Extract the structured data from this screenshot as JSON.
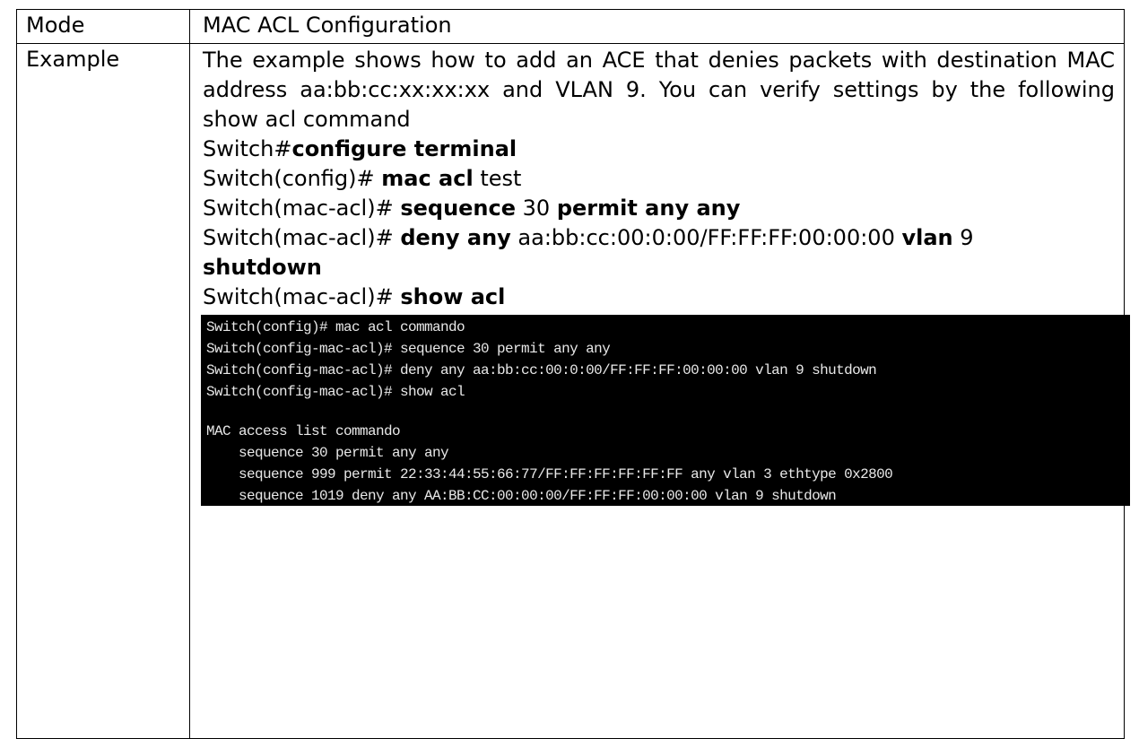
{
  "rows": {
    "mode": {
      "label": "Mode",
      "value": "MAC ACL Configuration"
    },
    "example": {
      "label": "Example",
      "description": "The example shows how to add an ACE that denies packets with destination MAC address aa:bb:cc:xx:xx:xx and VLAN 9. You can verify settings by the following show acl command",
      "commands": [
        {
          "prefix": "Switch#",
          "parts": [
            {
              "text": "configure terminal",
              "bold": true
            }
          ]
        },
        {
          "prefix": "Switch(config)# ",
          "parts": [
            {
              "text": "mac acl",
              "bold": true
            },
            {
              "text": " test",
              "bold": false
            }
          ]
        },
        {
          "prefix": "Switch(mac-acl)# ",
          "parts": [
            {
              "text": "sequence",
              "bold": true
            },
            {
              "text": " 30 ",
              "bold": false
            },
            {
              "text": "permit any any",
              "bold": true
            }
          ]
        },
        {
          "prefix": "Switch(mac-acl)# ",
          "parts": [
            {
              "text": "deny any",
              "bold": true
            },
            {
              "text": " aa:bb:cc:00:0:00/FF:FF:FF:00:00:00 ",
              "bold": false
            },
            {
              "text": "vlan",
              "bold": true
            },
            {
              "text": " 9",
              "bold": false
            }
          ]
        },
        {
          "prefix": "",
          "parts": [
            {
              "text": "shutdown",
              "bold": true
            }
          ]
        },
        {
          "prefix": "Switch(mac-acl)# ",
          "parts": [
            {
              "text": "show acl",
              "bold": true
            }
          ]
        }
      ],
      "terminal": [
        "Switch(config)# mac acl commando",
        "Switch(config-mac-acl)# sequence 30 permit any any",
        "Switch(config-mac-acl)# deny any aa:bb:cc:00:0:00/FF:FF:FF:00:00:00 vlan 9 shutdown",
        "Switch(config-mac-acl)# show acl",
        "",
        "MAC access list commando",
        "    sequence 30 permit any any",
        "    sequence 999 permit 22:33:44:55:66:77/FF:FF:FF:FF:FF:FF any vlan 3 ethtype 0x2800",
        "    sequence 1019 deny any AA:BB:CC:00:00:00/FF:FF:FF:00:00:00 vlan 9 shutdown"
      ]
    }
  }
}
